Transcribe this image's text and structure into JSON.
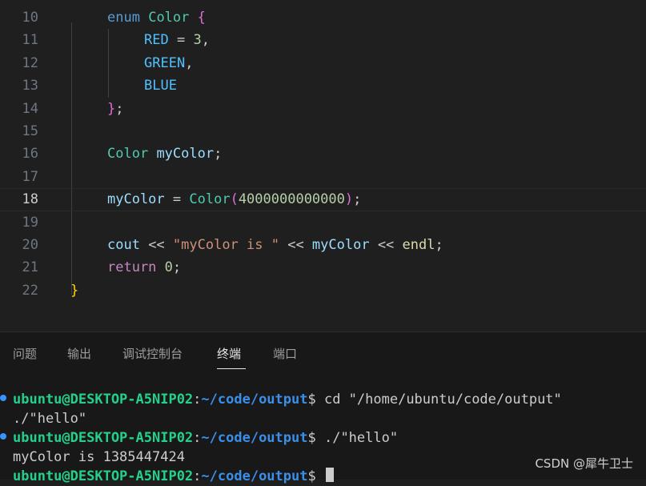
{
  "editor": {
    "line_numbers": [
      "10",
      "11",
      "12",
      "13",
      "14",
      "15",
      "16",
      "17",
      "18",
      "19",
      "20",
      "21",
      "22"
    ],
    "active_line": "18",
    "lines": {
      "l10": {
        "kw": "enum",
        "name": "Color",
        "brace": "{"
      },
      "l11": {
        "enumerator": "RED",
        "op": " = ",
        "value": "3",
        "comma": ","
      },
      "l12": {
        "enumerator": "GREEN",
        "comma": ","
      },
      "l13": {
        "enumerator": "BLUE"
      },
      "l14": {
        "brace": "}",
        "semi": ";"
      },
      "l16": {
        "type": "Color",
        "var": "myColor",
        "semi": ";"
      },
      "l18": {
        "var": "myColor",
        "op": " = ",
        "type": "Color",
        "open": "(",
        "value": "4000000000000",
        "close": ")",
        "semi": ";"
      },
      "l20": {
        "cout": "cout",
        "op1": " << ",
        "str": "\"myColor is \"",
        "op2": " << ",
        "var": "myColor",
        "op3": " << ",
        "endl": "endl",
        "semi": ";"
      },
      "l21": {
        "kw": "return",
        "value": "0",
        "semi": ";"
      },
      "l22": {
        "brace": "}"
      }
    }
  },
  "panel": {
    "tabs": [
      "问题",
      "输出",
      "调试控制台",
      "终端",
      "端口"
    ],
    "active_tab": "终端",
    "terminal": {
      "prompt_user": "ubuntu@DESKTOP-A5NIP02",
      "prompt_sep": ":",
      "prompt_path": "~/code/output",
      "prompt_symbol": "$",
      "line1_cmd": " cd \"/home/ubuntu/code/output\"",
      "line2": "./\"hello\"",
      "line3_cmd": " ./\"hello\"",
      "line4": "myColor is 1385447424",
      "line5_cmd": " "
    }
  },
  "watermark": "CSDN @犀牛卫士"
}
